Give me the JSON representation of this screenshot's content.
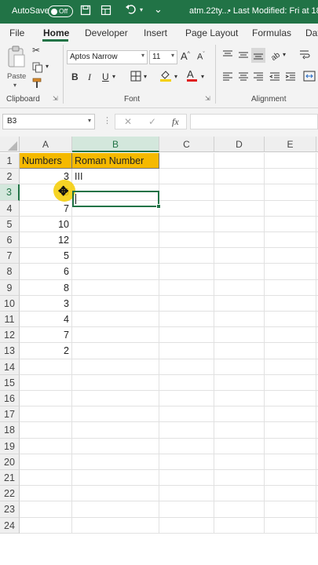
{
  "titlebar": {
    "autosave_label": "AutoSave",
    "autosave_state": "Off",
    "filename": "atm.22ty...",
    "modified": "• Last Modified: Fri at 18:",
    "save_icon": "save-icon",
    "undo_icon": "undo-icon"
  },
  "tabs": [
    "File",
    "Home",
    "Developer",
    "Insert",
    "Page Layout",
    "Formulas",
    "Dat"
  ],
  "active_tab": "Home",
  "ribbon": {
    "clipboard": {
      "label": "Clipboard",
      "paste_label": "Paste"
    },
    "font": {
      "label": "Font",
      "font_name": "Aptos Narrow",
      "font_size": "11"
    },
    "alignment": {
      "label": "Alignment"
    }
  },
  "formula_bar": {
    "name_box": "B3",
    "cancel_symbol": "✕",
    "enter_symbol": "✓",
    "fx_symbol": "fx",
    "content": ""
  },
  "columns": [
    "A",
    "B",
    "C",
    "D",
    "E"
  ],
  "rows": [
    "1",
    "2",
    "3",
    "4",
    "5",
    "6",
    "7",
    "8",
    "9",
    "10",
    "11",
    "12",
    "13",
    "14",
    "15",
    "16",
    "17",
    "18",
    "19",
    "20",
    "21",
    "22",
    "23",
    "24"
  ],
  "sheet": {
    "header_a": "Numbers",
    "header_b": "Roman Number",
    "numbers": [
      "3",
      "5",
      "7",
      "10",
      "12",
      "5",
      "6",
      "8",
      "3",
      "4",
      "7",
      "2"
    ],
    "b2": "III"
  },
  "selection": {
    "cell": "B3",
    "column": "B",
    "row": "3"
  },
  "colors": {
    "excel_green": "#217346",
    "header_fill": "#f5b900"
  }
}
